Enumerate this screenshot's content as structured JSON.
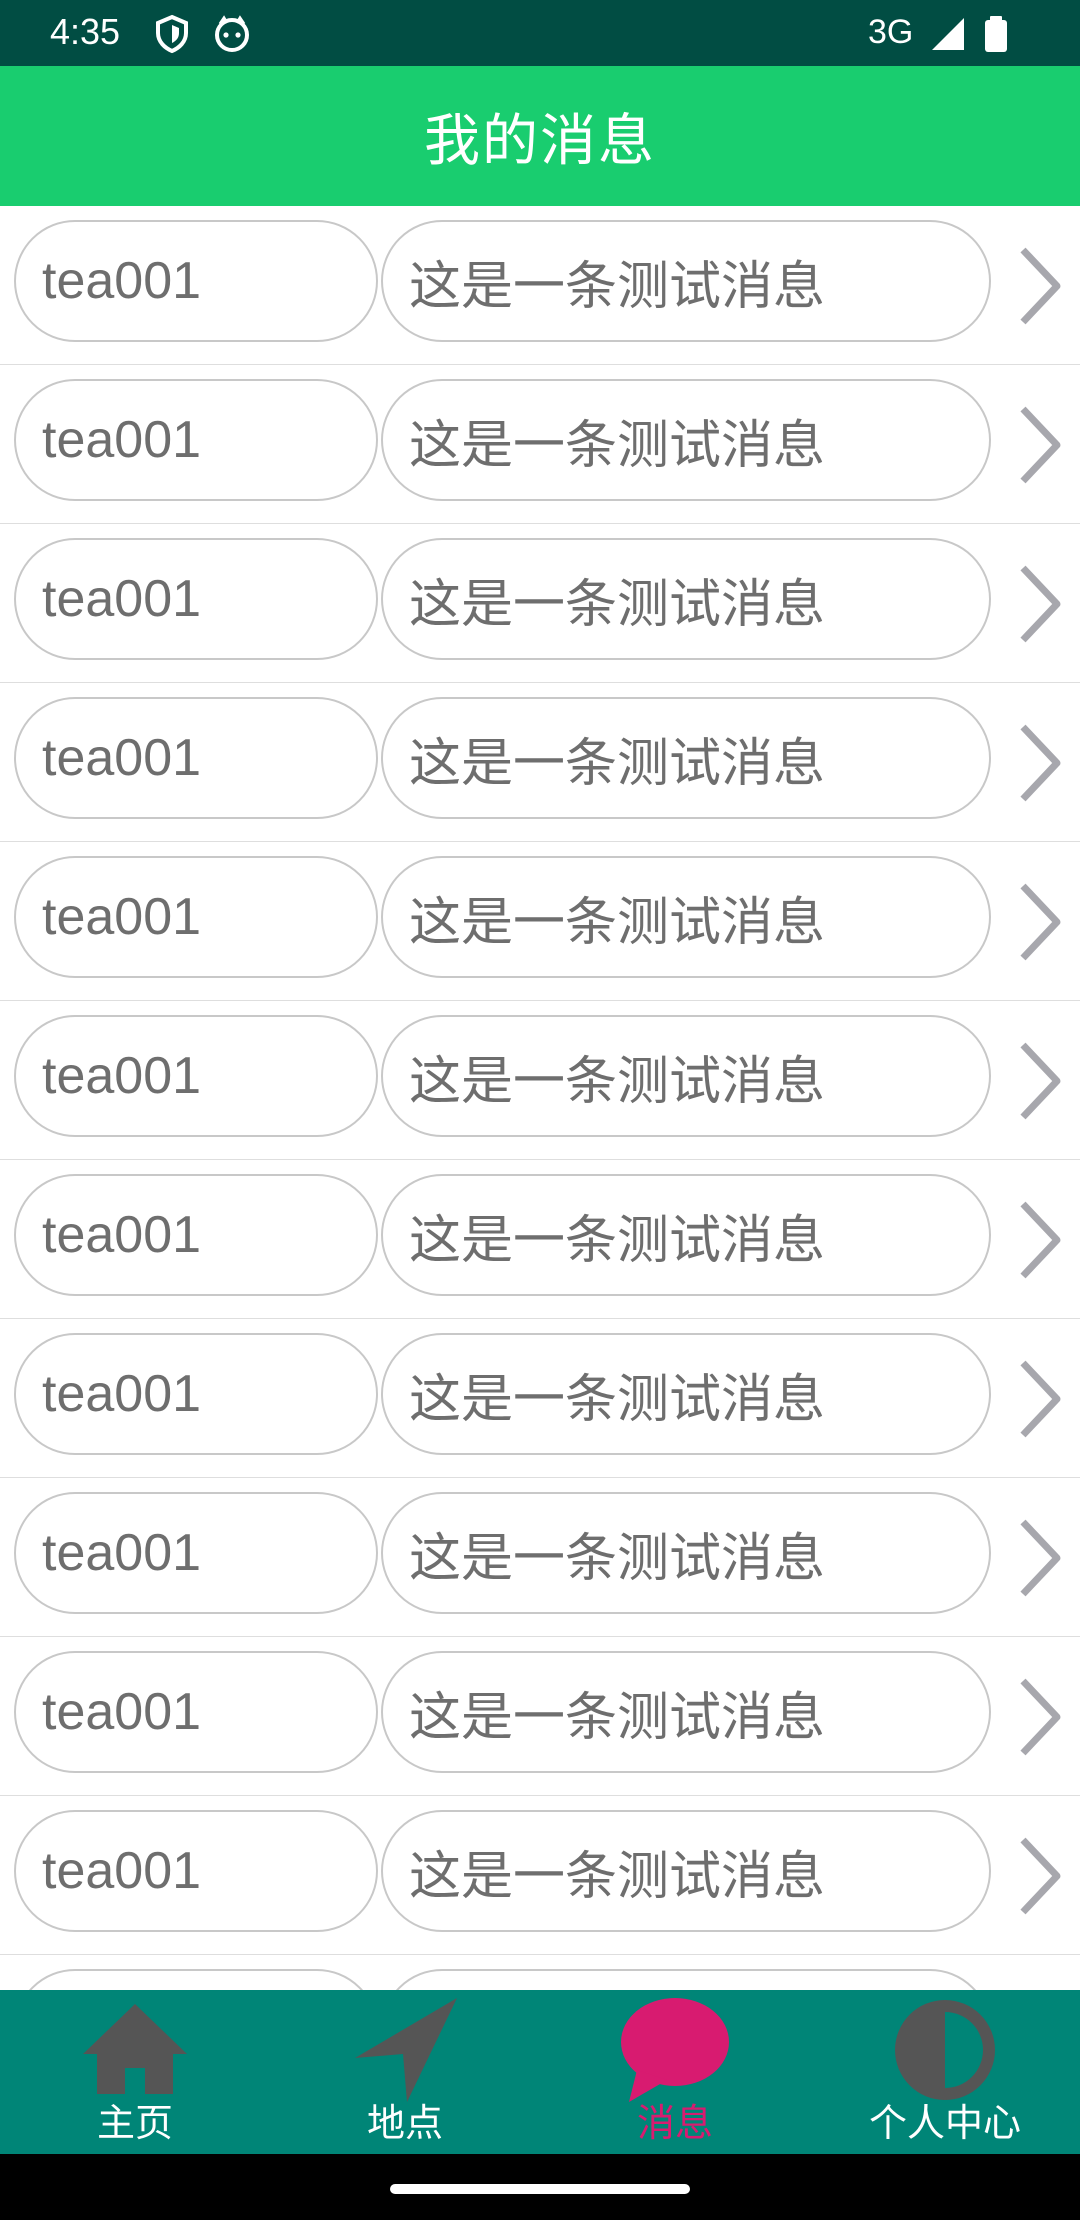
{
  "status_bar": {
    "time": "4:35",
    "network": "3G",
    "icons": [
      "shield-icon",
      "cat-face-icon",
      "signal-icon",
      "battery-icon"
    ]
  },
  "header": {
    "title": "我的消息"
  },
  "messages": [
    {
      "sender": "tea001",
      "content": "这是一条测试消息"
    },
    {
      "sender": "tea001",
      "content": "这是一条测试消息"
    },
    {
      "sender": "tea001",
      "content": "这是一条测试消息"
    },
    {
      "sender": "tea001",
      "content": "这是一条测试消息"
    },
    {
      "sender": "tea001",
      "content": "这是一条测试消息"
    },
    {
      "sender": "tea001",
      "content": "这是一条测试消息"
    },
    {
      "sender": "tea001",
      "content": "这是一条测试消息"
    },
    {
      "sender": "tea001",
      "content": "这是一条测试消息"
    },
    {
      "sender": "tea001",
      "content": "这是一条测试消息"
    },
    {
      "sender": "tea001",
      "content": "这是一条测试消息"
    },
    {
      "sender": "tea001",
      "content": "这是一条测试消息"
    },
    {
      "sender": "",
      "content": ""
    }
  ],
  "bottom_nav": {
    "items": [
      {
        "label": "主页",
        "icon": "home-icon"
      },
      {
        "label": "地点",
        "icon": "navigation-arrow-icon"
      },
      {
        "label": "消息",
        "icon": "chat-bubble-icon",
        "active": true
      },
      {
        "label": "个人中心",
        "icon": "half-circle-icon"
      }
    ]
  },
  "colors": {
    "status_bar": "#014d43",
    "app_bar": "#19cd6f",
    "bottom_nav": "#008577",
    "active_nav": "#d81b70",
    "inactive_icon": "#555555"
  }
}
